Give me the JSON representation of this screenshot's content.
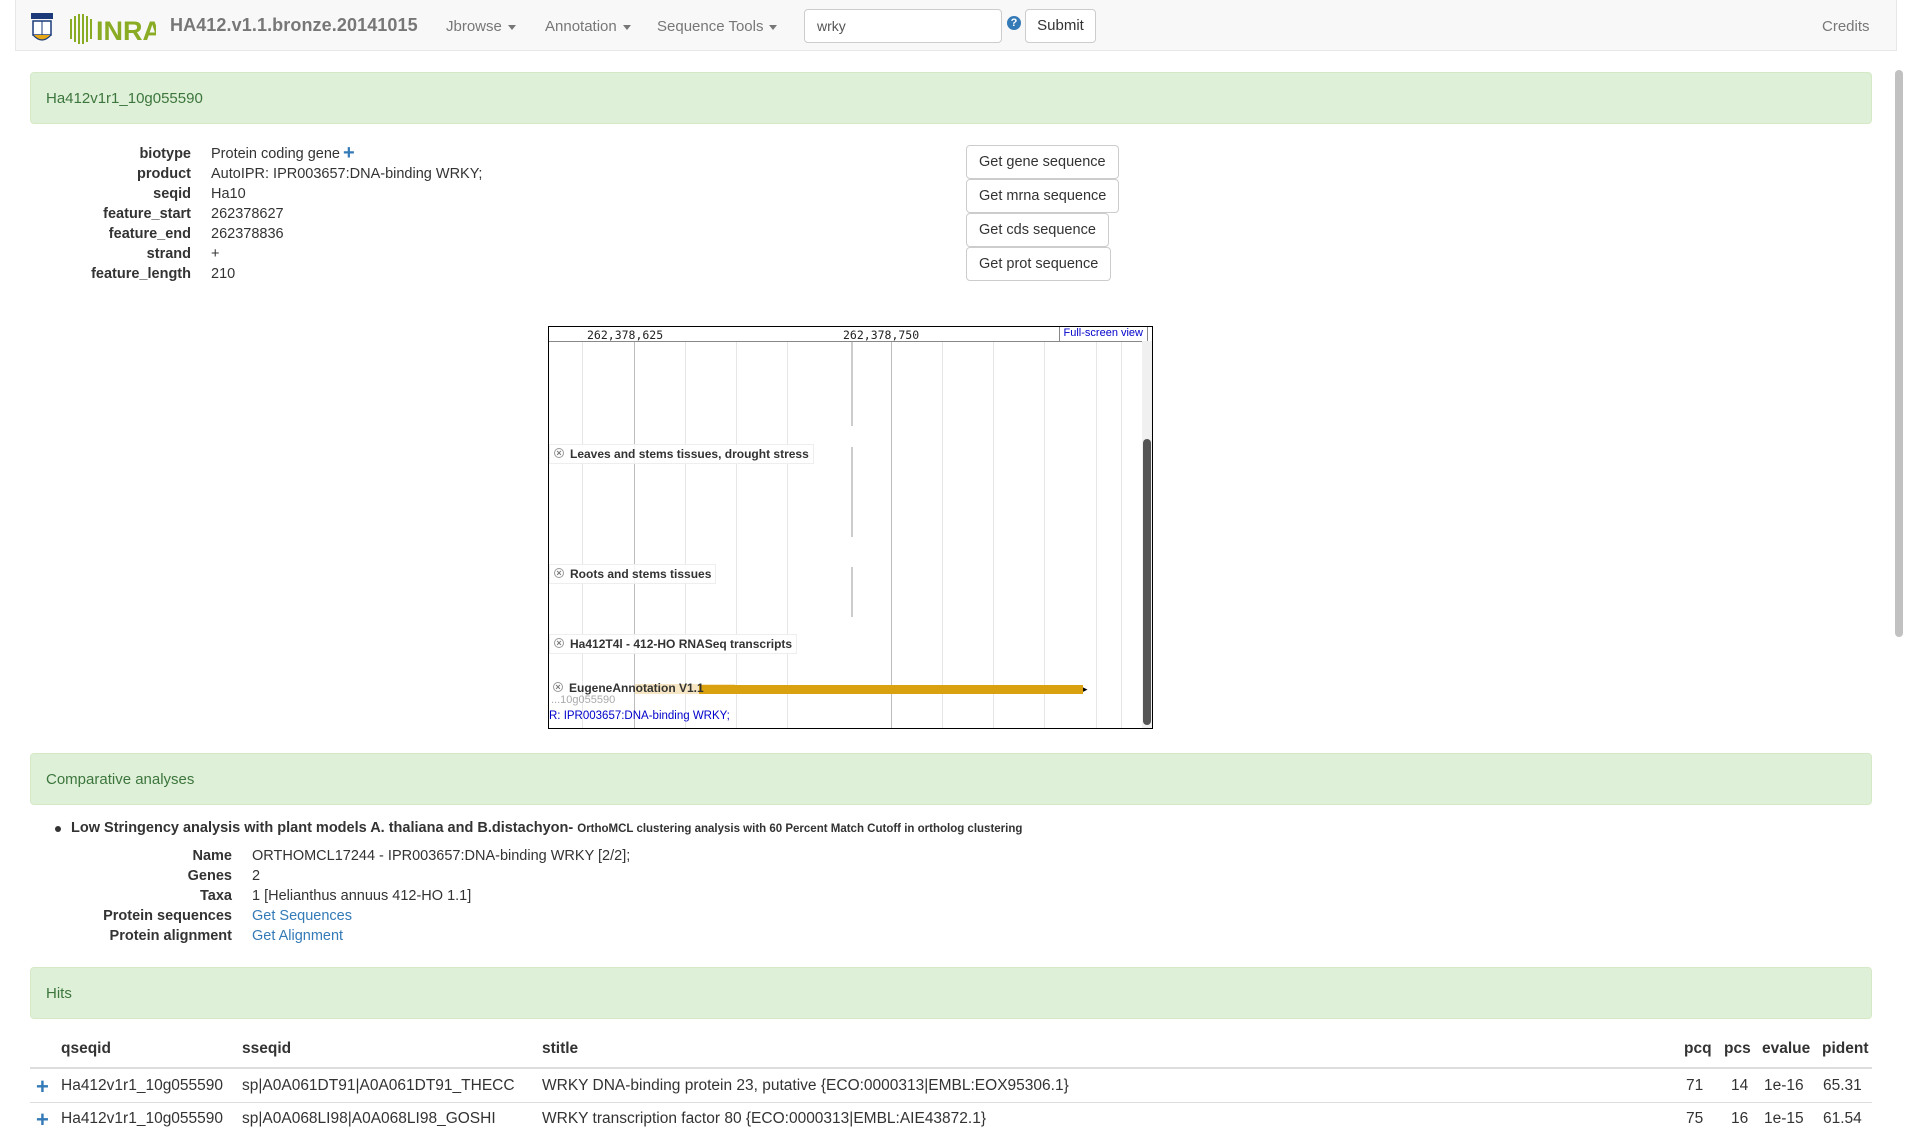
{
  "navbar": {
    "brand": "HA412.v1.1.bronze.20141015",
    "menus": [
      "Jbrowse",
      "Annotation",
      "Sequence Tools"
    ],
    "search_value": "wrky",
    "help_glyph": "?",
    "submit_label": "Submit",
    "credits_label": "Credits",
    "logo_text": "INRA"
  },
  "gene": {
    "heading": "Ha412v1r1_10g055590",
    "properties": [
      {
        "key": "biotype",
        "value": "Protein coding gene"
      },
      {
        "key": "product",
        "value": "AutoIPR: IPR003657:DNA-binding WRKY;"
      },
      {
        "key": "seqid",
        "value": "Ha10"
      },
      {
        "key": "feature_start",
        "value": "262378627"
      },
      {
        "key": "feature_end",
        "value": "262378836"
      },
      {
        "key": "strand",
        "value": "+"
      },
      {
        "key": "feature_length",
        "value": "210"
      }
    ],
    "sequence_buttons": [
      "Get gene sequence",
      "Get mrna sequence",
      "Get cds sequence",
      "Get prot sequence"
    ]
  },
  "jbrowse": {
    "ruler_labels": [
      "262,378,625",
      "262,378,750"
    ],
    "fullscreen_label": "Full-screen view",
    "tracks": [
      "Leaves and stems tissues, drought stress",
      "Roots and stems tissues",
      "Ha412T4l - 412-HO RNASeq transcripts",
      "EugeneAnnotation V1.1"
    ],
    "feature_description": "R: IPR003657:DNA-binding WRKY;",
    "feature_ghost_label": "...10g055590",
    "feature_color": "#d9a10f"
  },
  "comparative": {
    "heading": "Comparative analyses",
    "title": "Low Stringency analysis with plant models A. thaliana and B.distachyon-",
    "subtitle": "OrthoMCL clustering analysis with 60 Percent Match Cutoff in ortholog clustering",
    "fields": [
      {
        "key": "Name",
        "value": "ORTHOMCL17244 - IPR003657:DNA-binding WRKY [2/2];"
      },
      {
        "key": "Genes",
        "value": "2"
      },
      {
        "key": "Taxa",
        "value": "1 [Helianthus annuus 412-HO 1.1]"
      },
      {
        "key": "Protein sequences",
        "value": "Get Sequences"
      },
      {
        "key": "Protein alignment",
        "value": "Get Alignment"
      }
    ]
  },
  "hits": {
    "heading": "Hits",
    "columns": [
      "qseqid",
      "sseqid",
      "stitle",
      "pcq",
      "pcs",
      "evalue",
      "pident"
    ],
    "rows": [
      [
        "Ha412v1r1_10g055590",
        "sp|A0A061DT91|A0A061DT91_THECC",
        "WRKY DNA-binding protein 23, putative {ECO:0000313|EMBL:EOX95306.1}",
        "71",
        "14",
        "1e-16",
        "65.31"
      ],
      [
        "Ha412v1r1_10g055590",
        "sp|A0A068LI98|A0A068LI98_GOSHI",
        "WRKY transcription factor 80 {ECO:0000313|EMBL:AIE43872.1}",
        "75",
        "16",
        "1e-15",
        "61.54"
      ]
    ]
  },
  "colors": {
    "link": "#337ab7",
    "panel_bg": "#dff0d8",
    "panel_text": "#3c763d"
  }
}
